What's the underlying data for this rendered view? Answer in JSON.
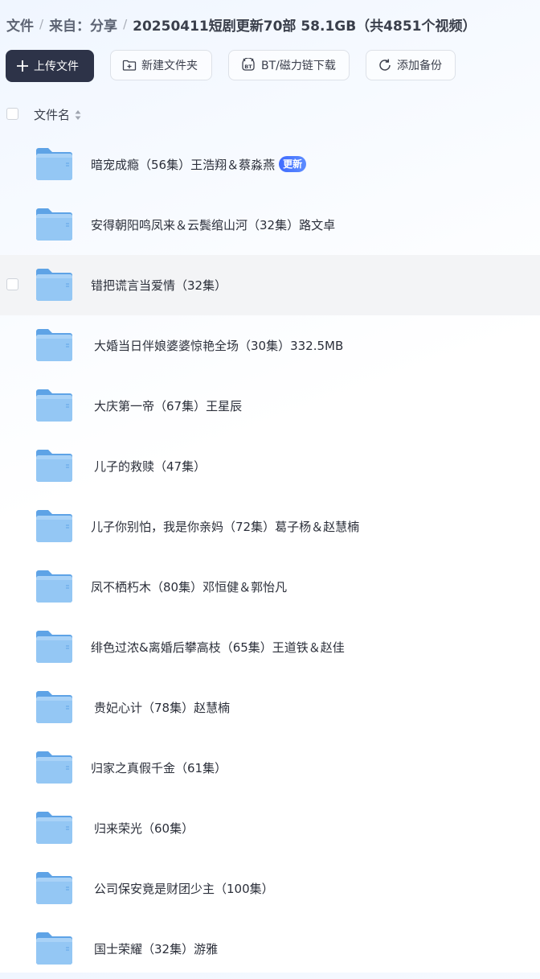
{
  "breadcrumb": {
    "root": "文件",
    "parent": "来自：分享",
    "current": "20250411短剧更新70部 58.1GB（共4851个视频）"
  },
  "toolbar": {
    "upload_label": "上传文件",
    "new_folder_label": "新建文件夹",
    "bt_label": "BT/磁力链下载",
    "backup_label": "添加备份"
  },
  "list": {
    "column_name": "文件名",
    "items": [
      {
        "name": "暗宠成瘾（56集）王浩翔＆蔡淼燕",
        "badge": "更新"
      },
      {
        "name": "安得朝阳鸣凤来＆云鬓绾山河（32集）路文卓"
      },
      {
        "name": "错把谎言当爱情（32集）"
      },
      {
        "name": "大婚当日伴娘婆婆惊艳全场（30集）332.5MB"
      },
      {
        "name": "大庆第一帝（67集）王星辰"
      },
      {
        "name": "儿子的救赎（47集）"
      },
      {
        "name": "儿子你别怕，我是你亲妈（72集）葛子杨＆赵慧楠"
      },
      {
        "name": "凤不栖朽木（80集）邓恒健＆郭怡凡"
      },
      {
        "name": "绯色过浓&离婚后攀高枝（65集）王道铁＆赵佳"
      },
      {
        "name": "贵妃心计（78集）赵慧楠"
      },
      {
        "name": "归家之真假千金（61集）"
      },
      {
        "name": "归来荣光（60集）"
      },
      {
        "name": "公司保安竟是财团少主（100集）"
      },
      {
        "name": "国士荣耀（32集）游雅"
      }
    ]
  },
  "icons": {
    "upload": "plus-icon",
    "new_folder": "folder-plus-icon",
    "bt": "bt-icon",
    "backup": "sync-icon",
    "sort": "sort-icon",
    "folder": "folder-icon"
  },
  "colors": {
    "primary_button": "#2d3348",
    "badge": "#4a78ff",
    "folder": "#7fb9f0"
  }
}
